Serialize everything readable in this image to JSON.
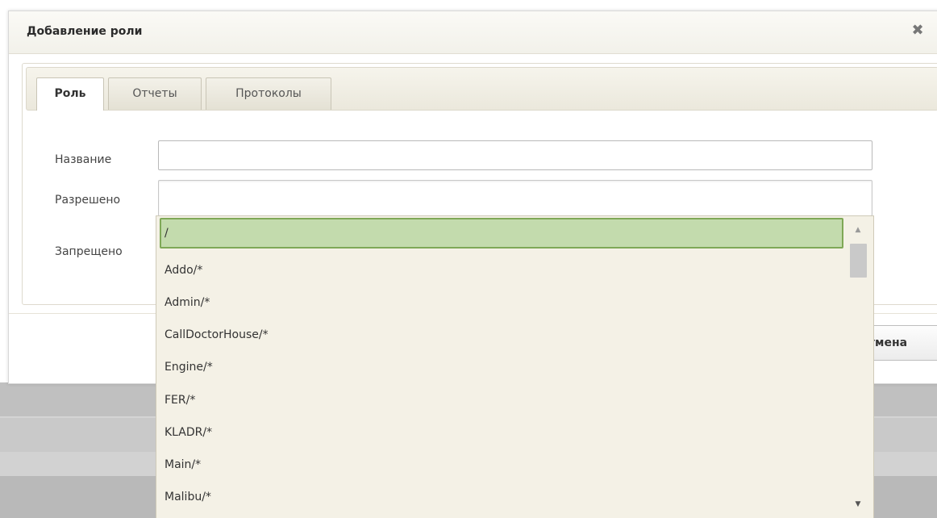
{
  "dialog": {
    "title": "Добавление роли",
    "close_icon": "close-icon"
  },
  "tabs": [
    {
      "label": "Роль",
      "active": true
    },
    {
      "label": "Отчеты",
      "active": false
    },
    {
      "label": "Протоколы",
      "active": false
    }
  ],
  "form": {
    "name_label": "Название",
    "name_value": "",
    "allowed_label": "Разрешено",
    "allowed_value": "",
    "forbidden_label": "Запрещено"
  },
  "footer": {
    "cancel_label": "Отмена"
  },
  "dropdown": {
    "items": [
      {
        "label": "/",
        "selected": true
      },
      {
        "label": "Addo/*",
        "selected": false
      },
      {
        "label": "Admin/*",
        "selected": false
      },
      {
        "label": "CallDoctorHouse/*",
        "selected": false
      },
      {
        "label": "Engine/*",
        "selected": false
      },
      {
        "label": "FER/*",
        "selected": false
      },
      {
        "label": "KLADR/*",
        "selected": false
      },
      {
        "label": "Main/*",
        "selected": false
      },
      {
        "label": "Malibu/*",
        "selected": false
      }
    ]
  },
  "colors": {
    "selected_bg": "#c3dbad",
    "selected_border": "#7fa857",
    "dropdown_bg": "#f4f1e6"
  }
}
